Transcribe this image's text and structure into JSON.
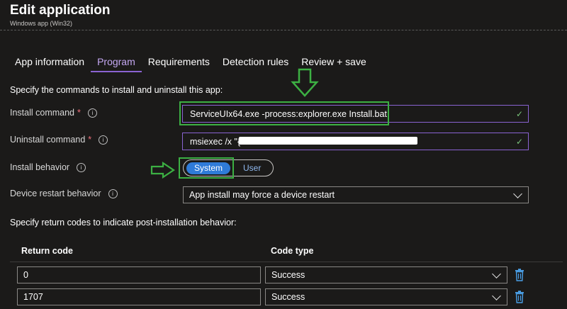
{
  "header": {
    "title": "Edit application",
    "subtitle": "Windows app (Win32)"
  },
  "tabs": [
    {
      "label": "App information",
      "active": false
    },
    {
      "label": "Program",
      "active": true
    },
    {
      "label": "Requirements",
      "active": false
    },
    {
      "label": "Detection rules",
      "active": false
    },
    {
      "label": "Review + save",
      "active": false
    }
  ],
  "form": {
    "intro": "Specify the commands to install and uninstall this app:",
    "install_command": {
      "label": "Install command",
      "required": "*",
      "value": "ServiceUIx64.exe -process:explorer.exe Install.bat"
    },
    "uninstall_command": {
      "label": "Uninstall command",
      "required": "*",
      "value": "msiexec /x \"{"
    },
    "install_behavior": {
      "label": "Install behavior",
      "options": [
        "System",
        "User"
      ],
      "selected": "System"
    },
    "restart_behavior": {
      "label": "Device restart behavior",
      "value": "App install may force a device restart"
    }
  },
  "return_codes": {
    "intro": "Specify return codes to indicate post-installation behavior:",
    "columns": [
      "Return code",
      "Code type"
    ],
    "rows": [
      {
        "code": "0",
        "type": "Success"
      },
      {
        "code": "1707",
        "type": "Success"
      }
    ]
  },
  "icons": {
    "info": "info-icon",
    "check": "checkmark-icon",
    "chevron": "chevron-down-icon",
    "delete": "trash-icon",
    "annotation_arrow": "arrow-annotation"
  },
  "colors": {
    "background": "#1b1a19",
    "active_tab": "#c4a8f2",
    "accent_border": "#8a63d2",
    "toggle_selected": "#2f7bd8",
    "required": "#f1707b",
    "annotation": "#3cb043",
    "delete_icon": "#4aa0e8"
  }
}
